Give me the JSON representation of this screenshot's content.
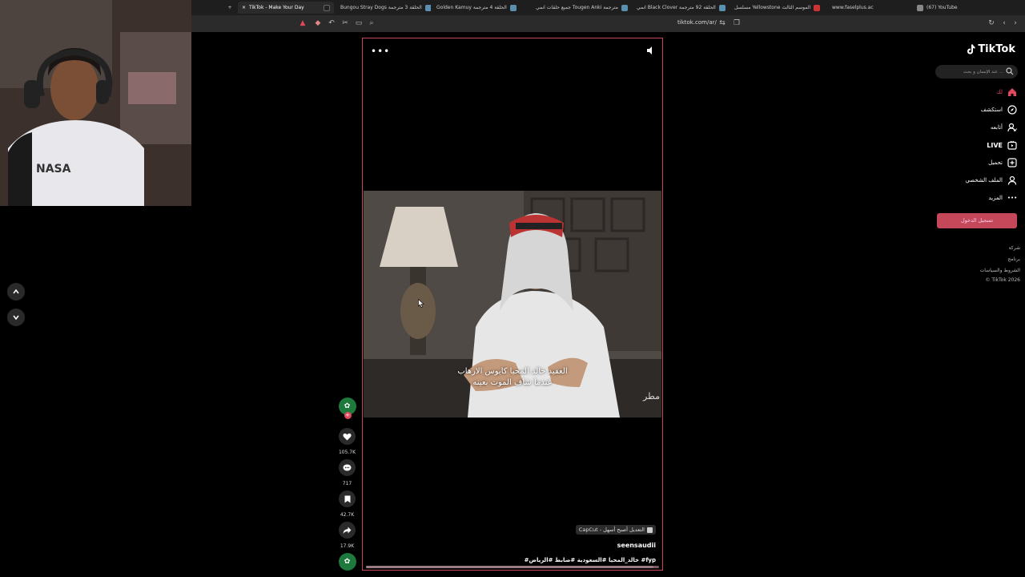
{
  "browser": {
    "tabs": [
      {
        "label": "TikTok - Make Your Day",
        "active": true,
        "icon": "tiktok-favicon"
      },
      {
        "label": "Bungou Stray Dogs الحلقة 3 مترجمة",
        "icon": "site-favicon"
      },
      {
        "label": "Golden Kamuy الحلقة 4 مترجمة",
        "icon": "site-favicon"
      },
      {
        "label": "جميع حلقات انمي Tougen Anki مترجمة",
        "icon": "site-favicon"
      },
      {
        "label": "انمي Black Clover الحلقة 92 مترجمة",
        "icon": "site-favicon"
      },
      {
        "label": "مسلسل Yellowstone الموسم الثالث",
        "icon": "red-favicon"
      },
      {
        "label": "www.faselplus.ac",
        "icon": "site-favicon"
      },
      {
        "label": "(67) YouTube",
        "icon": "youtube-favicon"
      }
    ],
    "new_tab_symbol": "+",
    "close_symbol": "×",
    "url": "tiktok.com/ar/"
  },
  "video": {
    "subtitle_line1": "العقيد خالد المحيا كابوس الارهاب",
    "subtitle_line2": "عندما شاف الموت بعينه",
    "watermark": "مطر",
    "capcut_label": "CapCut - التعديل أصبح أسهل",
    "author": "seensaudii",
    "hashtags": "#خالد_المحيا #السعودية #ضابط #الرياض #fyp",
    "progress_fraction": 0.98
  },
  "actions": {
    "likes": "105.7K",
    "comments": "717",
    "saves": "42.7K",
    "shares": "17.9K"
  },
  "sidebar": {
    "logo_text": "TikTok",
    "search_placeholder": "عند الإنسان و بحث ...",
    "menu": [
      {
        "label": "لك",
        "icon": "home-icon",
        "active": true
      },
      {
        "label": "استكشف",
        "icon": "compass-icon"
      },
      {
        "label": "أتابعه",
        "icon": "following-icon"
      },
      {
        "label": "LIVE",
        "icon": "live-icon"
      },
      {
        "label": "تحميل",
        "icon": "upload-icon"
      },
      {
        "label": "الملف الشخصي",
        "icon": "profile-icon"
      },
      {
        "label": "المزيد",
        "icon": "more-icon"
      }
    ],
    "login_label": "تسجيل الدخول",
    "footer": [
      "شركة",
      "برنامج",
      "الشروط والسياسات",
      "© TikTok 2026"
    ]
  },
  "colors": {
    "accent": "#c4475a",
    "active_menu": "#e0475c",
    "background": "#000000"
  }
}
